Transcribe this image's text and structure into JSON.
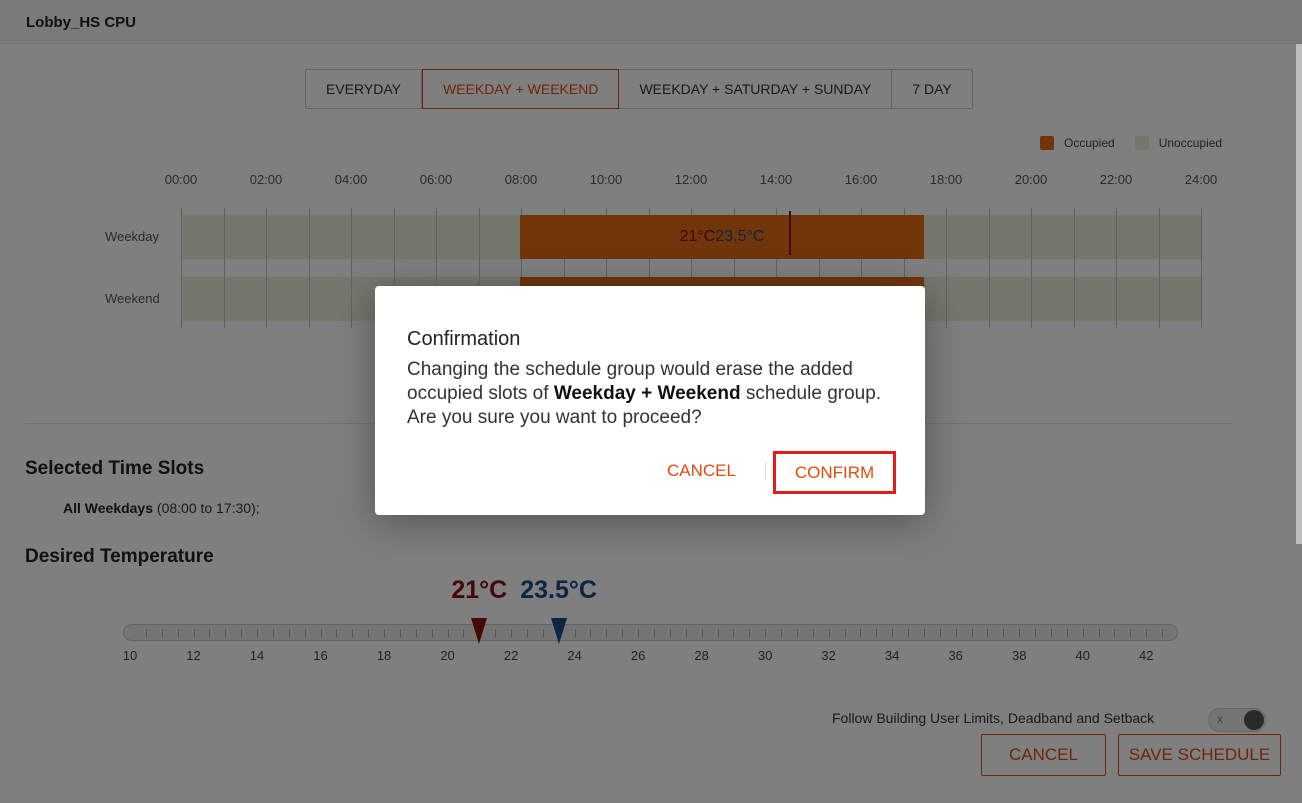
{
  "window": {
    "title": "Lobby_HS CPU"
  },
  "schedule_tabs": [
    {
      "label": "EVERYDAY",
      "active": false
    },
    {
      "label": "WEEKDAY + WEEKEND",
      "active": true
    },
    {
      "label": "WEEKDAY + SATURDAY + SUNDAY",
      "active": false
    },
    {
      "label": "7 DAY",
      "active": false
    }
  ],
  "legend": {
    "occupied": {
      "label": "Occupied",
      "color": "#e06a17"
    },
    "unoccupied": {
      "label": "Unoccupied",
      "color": "#e9efd9"
    }
  },
  "timeline": {
    "time_labels": [
      "00:00",
      "02:00",
      "04:00",
      "06:00",
      "08:00",
      "10:00",
      "12:00",
      "14:00",
      "16:00",
      "18:00",
      "20:00",
      "22:00",
      "24:00"
    ],
    "rows": [
      {
        "label": "Weekday",
        "occupied_start": "08:00",
        "occupied_end": "17:30",
        "heating": "21°C",
        "cooling": "23.5°C"
      },
      {
        "label": "Weekend",
        "occupied_start": "08:00",
        "occupied_end": "17:30"
      }
    ]
  },
  "selected_time_slots": {
    "heading": "Selected Time Slots",
    "entry_bold": "All Weekdays",
    "entry_rest": " (08:00 to 17:30);"
  },
  "desired_temperature": {
    "heading": "Desired Temperature",
    "heating_value": 21,
    "heating_label": "21°C",
    "cooling_value": 23.5,
    "cooling_label": "23.5°C",
    "scale_min": 10,
    "scale_max": 43,
    "scale_labels": [
      "10",
      "12",
      "14",
      "16",
      "18",
      "20",
      "22",
      "24",
      "26",
      "28",
      "30",
      "32",
      "34",
      "36",
      "38",
      "40",
      "42"
    ],
    "heating_color": "#8a1010",
    "cooling_color": "#1a4a88"
  },
  "follow_limits": {
    "label": "Follow Building User Limits, Deadband and Setback",
    "toggle_mark": "x"
  },
  "footer": {
    "cancel_label": "CANCEL",
    "save_label": "SAVE SCHEDULE"
  },
  "dialog": {
    "title": "Confirmation",
    "message_part1": "Changing the schedule group would erase the added occupied slots of ",
    "message_bold": "Weekday + Weekend",
    "message_part2": " schedule group. Are you sure you want to proceed?",
    "cancel_label": "CANCEL",
    "confirm_label": "CONFIRM"
  }
}
